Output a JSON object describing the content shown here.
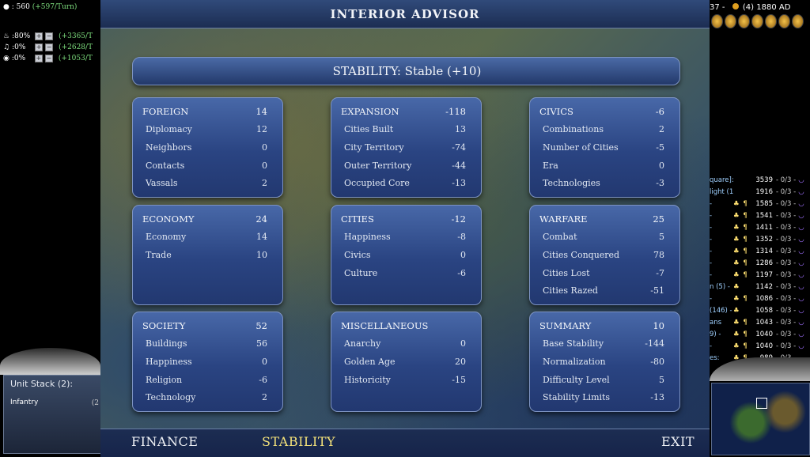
{
  "window": {
    "title": "INTERIOR ADVISOR",
    "stability_banner": "STABILITY: Stable (+10)",
    "tabs": {
      "finance": "FINANCE",
      "stability": "STABILITY",
      "exit": "EXIT"
    }
  },
  "panels": {
    "foreign": {
      "label": "FOREIGN",
      "total": "14",
      "rows": [
        {
          "label": "Diplomacy",
          "value": "12"
        },
        {
          "label": "Neighbors",
          "value": "0"
        },
        {
          "label": "Contacts",
          "value": "0"
        },
        {
          "label": "Vassals",
          "value": "2"
        }
      ]
    },
    "expansion": {
      "label": "EXPANSION",
      "total": "-118",
      "rows": [
        {
          "label": "Cities Built",
          "value": "13"
        },
        {
          "label": "City Territory",
          "value": "-74"
        },
        {
          "label": "Outer Territory",
          "value": "-44"
        },
        {
          "label": "Occupied Core",
          "value": "-13"
        }
      ]
    },
    "civics": {
      "label": "CIVICS",
      "total": "-6",
      "rows": [
        {
          "label": "Combinations",
          "value": "2"
        },
        {
          "label": "Number of Cities",
          "value": "-5"
        },
        {
          "label": "Era",
          "value": "0"
        },
        {
          "label": "Technologies",
          "value": "-3"
        }
      ]
    },
    "economy": {
      "label": "ECONOMY",
      "total": "24",
      "rows": [
        {
          "label": "Economy",
          "value": "14"
        },
        {
          "label": "Trade",
          "value": "10"
        }
      ]
    },
    "cities": {
      "label": "CITIES",
      "total": "-12",
      "rows": [
        {
          "label": "Happiness",
          "value": "-8"
        },
        {
          "label": "Civics",
          "value": "0"
        },
        {
          "label": "Culture",
          "value": "-6"
        }
      ]
    },
    "warfare": {
      "label": "WARFARE",
      "total": "25",
      "rows": [
        {
          "label": "Combat",
          "value": "5"
        },
        {
          "label": "Cities Conquered",
          "value": "78"
        },
        {
          "label": "Cities Lost",
          "value": "-7"
        },
        {
          "label": "Cities Razed",
          "value": "-51"
        }
      ]
    },
    "society": {
      "label": "SOCIETY",
      "total": "52",
      "rows": [
        {
          "label": "Buildings",
          "value": "56"
        },
        {
          "label": "Happiness",
          "value": "0"
        },
        {
          "label": "Religion",
          "value": "-6"
        },
        {
          "label": "Technology",
          "value": "2"
        }
      ]
    },
    "misc": {
      "label": "MISCELLANEOUS",
      "total": "",
      "rows": [
        {
          "label": "Anarchy",
          "value": "0"
        },
        {
          "label": "Golden Age",
          "value": "20"
        },
        {
          "label": "Historicity",
          "value": "-15"
        }
      ]
    },
    "summary": {
      "label": "SUMMARY",
      "total": "10",
      "rows": [
        {
          "label": "Base Stability",
          "value": "-144"
        },
        {
          "label": "Normalization",
          "value": "-80"
        },
        {
          "label": "Difficulty Level",
          "value": "5"
        },
        {
          "label": "Stability Limits",
          "value": "-13"
        }
      ]
    }
  },
  "hud": {
    "gold": ": 560",
    "gold_rate": "(+597/Turn)",
    "sliders": [
      {
        "pct": ":80%",
        "amount": "(+3365/T"
      },
      {
        "pct": ":0%",
        "amount": "(+2628/T"
      },
      {
        "pct": ":0%",
        "amount": "(+1053/T"
      }
    ],
    "slider_plus": "+",
    "slider_minus": "−",
    "date": "37 -",
    "date_turn": "(4) 1880 AD",
    "unit_stack_title": "Unit Stack (2):",
    "unit_stack_item": "Infantry",
    "unit_stack_cut": "(2",
    "scores": [
      {
        "name": "quare]:",
        "icons": "",
        "score": "3539",
        "war": "- 0/3 -"
      },
      {
        "name": "light (1) -",
        "icons": "",
        "score": "1916",
        "war": "- 0/3 -"
      },
      {
        "name": "-",
        "icons": "♣ ¶",
        "score": "1585",
        "war": "- 0/3 -"
      },
      {
        "name": "-",
        "icons": "♣ ¶",
        "score": "1541",
        "war": "- 0/3 -"
      },
      {
        "name": "-",
        "icons": "♣ ¶",
        "score": "1411",
        "war": "- 0/3 -"
      },
      {
        "name": "-",
        "icons": "♣ ¶",
        "score": "1352",
        "war": "- 0/3 -"
      },
      {
        "name": "-",
        "icons": "♣ ¶",
        "score": "1314",
        "war": "- 0/3 -"
      },
      {
        "name": "-",
        "icons": "♣ ¶",
        "score": "1286",
        "war": "- 0/3 -"
      },
      {
        "name": "-",
        "icons": "♣ ¶",
        "score": "1197",
        "war": "- 0/3 -"
      },
      {
        "name": "n (5) -",
        "icons": "♣",
        "score": "1142",
        "war": "- 0/3 -"
      },
      {
        "name": "-",
        "icons": "♣ ¶",
        "score": "1086",
        "war": "- 0/3 -"
      },
      {
        "name": "(146) -",
        "icons": "♣",
        "score": "1058",
        "war": "- 0/3 -"
      },
      {
        "name": "ans",
        "icons": "♣ ¶",
        "score": "1043",
        "war": "- 0/3 -"
      },
      {
        "name": "9) -",
        "icons": "♣ ¶",
        "score": "1040",
        "war": "- 0/3 -"
      },
      {
        "name": "-",
        "icons": "♣ ¶",
        "score": "1040",
        "war": "- 0/3 -"
      },
      {
        "name": "es:",
        "icons": "♣ ¶",
        "score": "989",
        "war": "- 0/3 -"
      }
    ]
  }
}
